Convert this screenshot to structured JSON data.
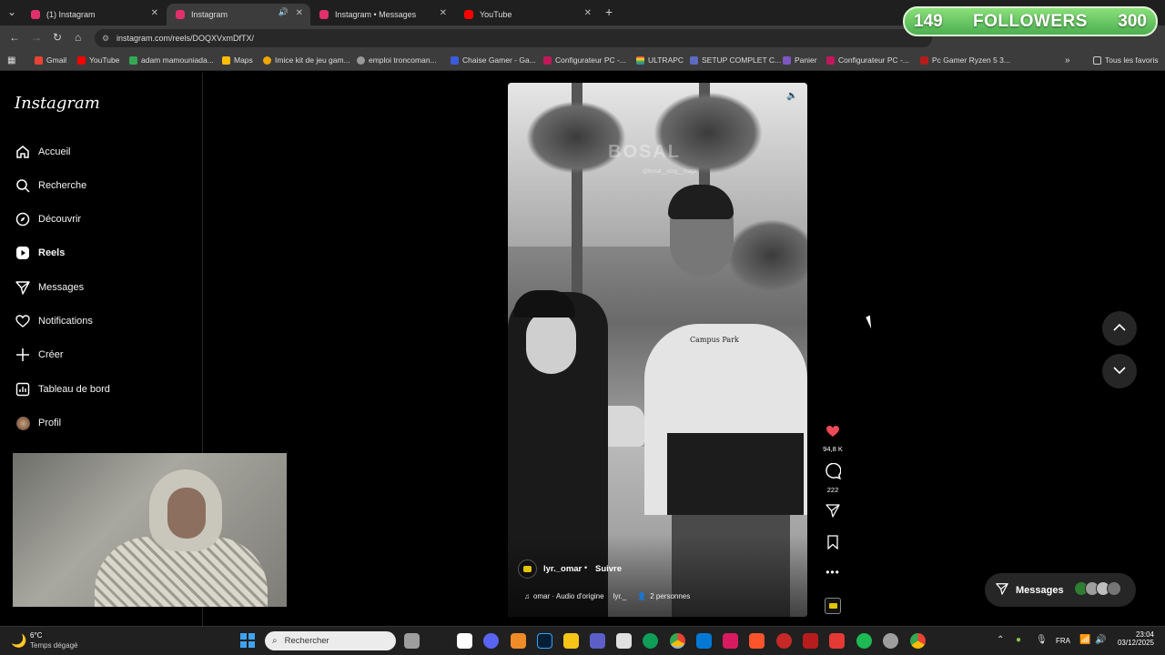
{
  "browser": {
    "tabs": [
      {
        "title": "(1) Instagram",
        "active": false
      },
      {
        "title": "Instagram",
        "active": true
      },
      {
        "title": "Instagram • Messages",
        "active": false
      },
      {
        "title": "YouTube",
        "active": false
      }
    ],
    "url": "instagram.com/reels/DOQXVxmDfTX/",
    "bookmarks": [
      "Gmail",
      "YouTube",
      "adam mamouniada...",
      "Maps",
      "Imice kit de jeu gam...",
      "emploi troncoman...",
      "Chaise Gamer - Ga...",
      "Configurateur PC -...",
      "ULTRAPC",
      "SETUP COMPLET C...",
      "Panier",
      "Configurateur PC -...",
      "Pc Gamer Ryzen 5 3..."
    ],
    "bookmarks_all": "Tous les favoris"
  },
  "followers_widget": {
    "current": "149",
    "label": "FOLLOWERS",
    "goal": "300"
  },
  "sidebar": {
    "logo": "Instagram",
    "items": [
      {
        "label": "Accueil",
        "icon": "home-icon"
      },
      {
        "label": "Recherche",
        "icon": "search-icon"
      },
      {
        "label": "Découvrir",
        "icon": "compass-icon"
      },
      {
        "label": "Reels",
        "icon": "reels-icon"
      },
      {
        "label": "Messages",
        "icon": "send-icon"
      },
      {
        "label": "Notifications",
        "icon": "heart-icon"
      },
      {
        "label": "Créer",
        "icon": "plus-icon"
      },
      {
        "label": "Tableau de bord",
        "icon": "dashboard-icon"
      },
      {
        "label": "Profil",
        "icon": "avatar"
      }
    ]
  },
  "reel": {
    "watermark": "BOSAL",
    "watermark_sub": "@bosal__king__mage",
    "shirt_text": "Campus Park",
    "author": "lyr._omar",
    "dot": "•",
    "follow": "Suivre",
    "audio": "omar · Audio d'origine",
    "audio_user": "lyr._",
    "people": "2 personnes",
    "likes": "94,8 K",
    "comments": "222"
  },
  "messages_pill": {
    "label": "Messages"
  },
  "taskbar": {
    "temp": "6°C",
    "weather": "Temps dégagé",
    "search_placeholder": "Rechercher",
    "lang": "FRA",
    "time": "23:04",
    "date": "03/12/2025"
  },
  "colors": {
    "like": "#ed4956",
    "accent": "#3fa3f5",
    "widget": "#4caf50"
  }
}
